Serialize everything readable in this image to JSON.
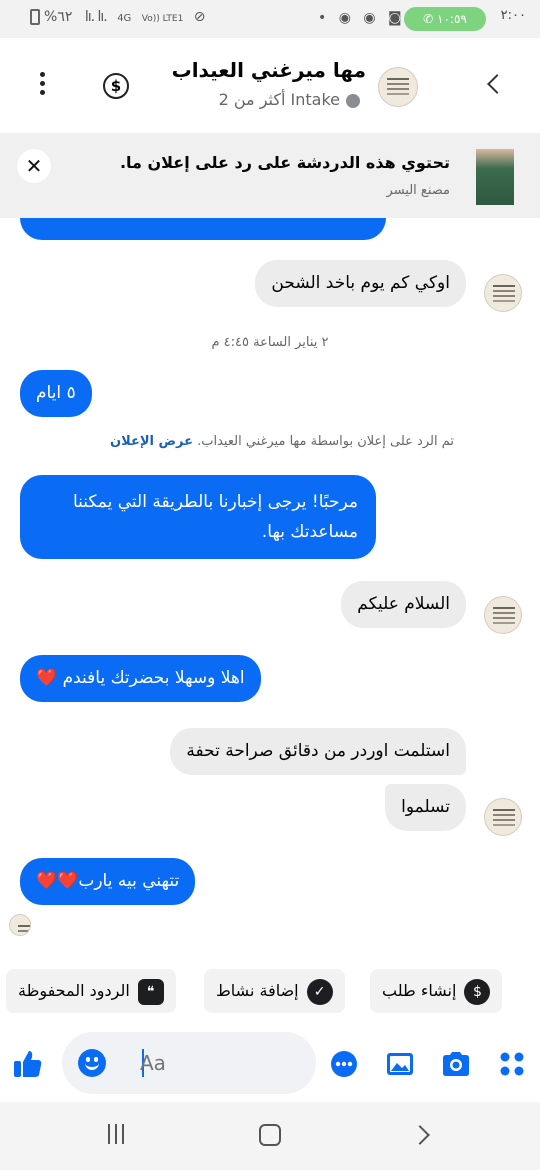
{
  "status_bar": {
    "clock": "٢:٠٠",
    "call_pill": "١٠:٥٩",
    "battery": "%٦٢",
    "network": "4G",
    "volte": "Vo)) LTE1"
  },
  "header": {
    "contact_name": "مها ميرغني العيداب",
    "status_label": "Intake",
    "more_count": "أكثر من 2",
    "icons": [
      "back-icon",
      "dollar-icon",
      "more-icon"
    ]
  },
  "banner": {
    "title": "تحتوي هذه الدردشة على رد على إعلان ما.",
    "subtitle": "مصنع اليسر"
  },
  "messages": [
    {
      "dir": "in",
      "text": "اوكي كم يوم باخد الشحن"
    },
    {
      "dir": "meta",
      "text": "٢ يناير الساعة ٤:٤٥ م"
    },
    {
      "dir": "out",
      "text": "٥ ايام"
    },
    {
      "dir": "ad",
      "text": "تم الرد على إعلان بواسطة مها ميرغني العيداب.",
      "link": "عرض الإعلان"
    },
    {
      "dir": "out",
      "text": "مرحبًا! يرجى إخبارنا بالطريقة التي يمكننا",
      "text2": "مساعدتك بها."
    },
    {
      "dir": "in",
      "text": "السلام عليكم"
    },
    {
      "dir": "out",
      "text": "اهلا وسهلا بحضرتك يافندم ❤️"
    },
    {
      "dir": "in",
      "text": "استلمت اوردر من دقائق صراحة تحفة"
    },
    {
      "dir": "in",
      "text": "تسلموا"
    },
    {
      "dir": "out",
      "text": "تتهني بيه يارب❤️❤️"
    }
  ],
  "quick_replies": [
    {
      "label": "إنشاء طلب",
      "icon": "dollar-icon"
    },
    {
      "label": "إضافة نشاط",
      "icon": "check-icon"
    },
    {
      "label": "الردود المحفوظة",
      "icon": "chat-bubbles-icon"
    }
  ],
  "composer": {
    "placeholder": "Aa"
  },
  "colors": {
    "accent": "#0a6cf5",
    "incoming_bubble": "#ececec",
    "banner_bg": "#f0f0f0"
  }
}
